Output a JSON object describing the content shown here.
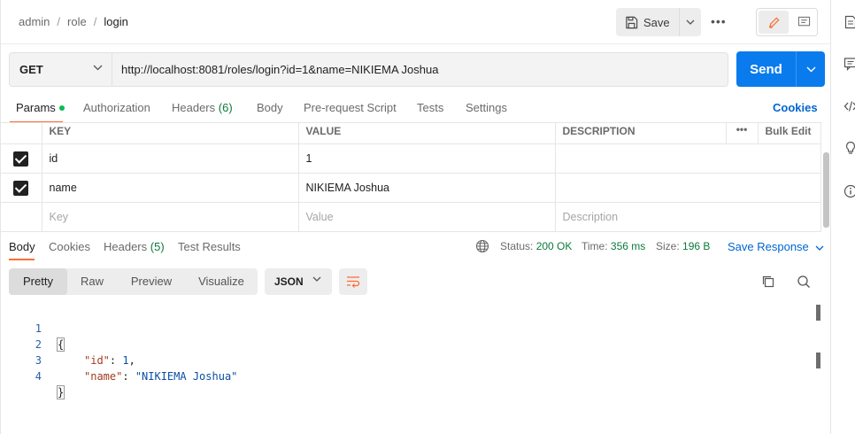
{
  "breadcrumb": {
    "items": [
      "admin",
      "role"
    ],
    "current": "login",
    "separator": "/"
  },
  "toolbar": {
    "save_label": "Save",
    "more_label": "•••"
  },
  "request": {
    "method": "GET",
    "url": "http://localhost:8081/roles/login?id=1&name=NIKIEMA Joshua",
    "send_label": "Send"
  },
  "request_tabs": {
    "params": "Params",
    "authorization": "Authorization",
    "headers": "Headers",
    "headers_count": "(6)",
    "body": "Body",
    "prerequest": "Pre-request Script",
    "tests": "Tests",
    "settings": "Settings",
    "cookies": "Cookies"
  },
  "params_table": {
    "headers": {
      "key": "KEY",
      "value": "VALUE",
      "description": "DESCRIPTION",
      "more": "•••",
      "bulk_edit": "Bulk Edit"
    },
    "rows": [
      {
        "key": "id",
        "value": "1",
        "description": ""
      },
      {
        "key": "name",
        "value": "NIKIEMA Joshua",
        "description": ""
      }
    ],
    "placeholder": {
      "key": "Key",
      "value": "Value",
      "description": "Description"
    }
  },
  "response_tabs": {
    "body": "Body",
    "cookies": "Cookies",
    "headers": "Headers",
    "headers_count": "(5)",
    "test_results": "Test Results"
  },
  "status": {
    "status_label": "Status:",
    "status_value": "200 OK",
    "time_label": "Time:",
    "time_value": "356 ms",
    "size_label": "Size:",
    "size_value": "196 B",
    "save_response": "Save Response"
  },
  "format": {
    "modes": [
      "Pretty",
      "Raw",
      "Preview",
      "Visualize"
    ],
    "active_mode": "Pretty",
    "language": "JSON"
  },
  "response_body": {
    "line_numbers": [
      "1",
      "2",
      "3",
      "4"
    ],
    "open_brace": "{",
    "close_brace": "}",
    "id_key": "\"id\"",
    "id_value": "1",
    "name_key": "\"name\"",
    "name_value": "\"NIKIEMA Joshua\""
  },
  "colors": {
    "accent": "#ff6c37",
    "primary": "#097bed",
    "success": "#0b7a3c",
    "link": "#0265d2"
  }
}
